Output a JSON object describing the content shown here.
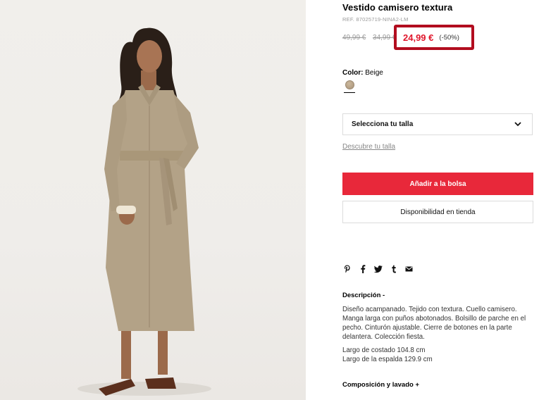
{
  "product": {
    "title": "Vestido camisero textura",
    "ref": "REF. 87025719-NINA2-LM",
    "old_price_1": "49,99 €",
    "old_price_2": "34,99 €",
    "price": "24,99 €",
    "discount": "(-50%)",
    "price_color": "#e0162b"
  },
  "color": {
    "label": "Color:",
    "value": "Beige",
    "swatch_color": "#b8a386"
  },
  "size": {
    "select_label": "Selecciona tu talla",
    "guide_link": "Descubre tu talla"
  },
  "actions": {
    "add_to_bag": "Añadir a la bolsa",
    "store_availability": "Disponibilidad en tienda",
    "accent_color": "#e8283a"
  },
  "share": [
    "pinterest-icon",
    "facebook-icon",
    "twitter-icon",
    "tumblr-icon",
    "email-icon"
  ],
  "description": {
    "heading": "Descripción  -",
    "text": "Diseño acampanado. Tejido con textura. Cuello camisero. Manga larga con puños abotonados. Bolsillo de parche en el pecho. Cinturón ajustable. Cierre de botones en la parte delantera. Colección fiesta.",
    "measure_1": "Largo de costado 104.8 cm",
    "measure_2": "Largo de la espalda 129.9 cm"
  },
  "composition": {
    "heading": "Composición y lavado  +"
  }
}
